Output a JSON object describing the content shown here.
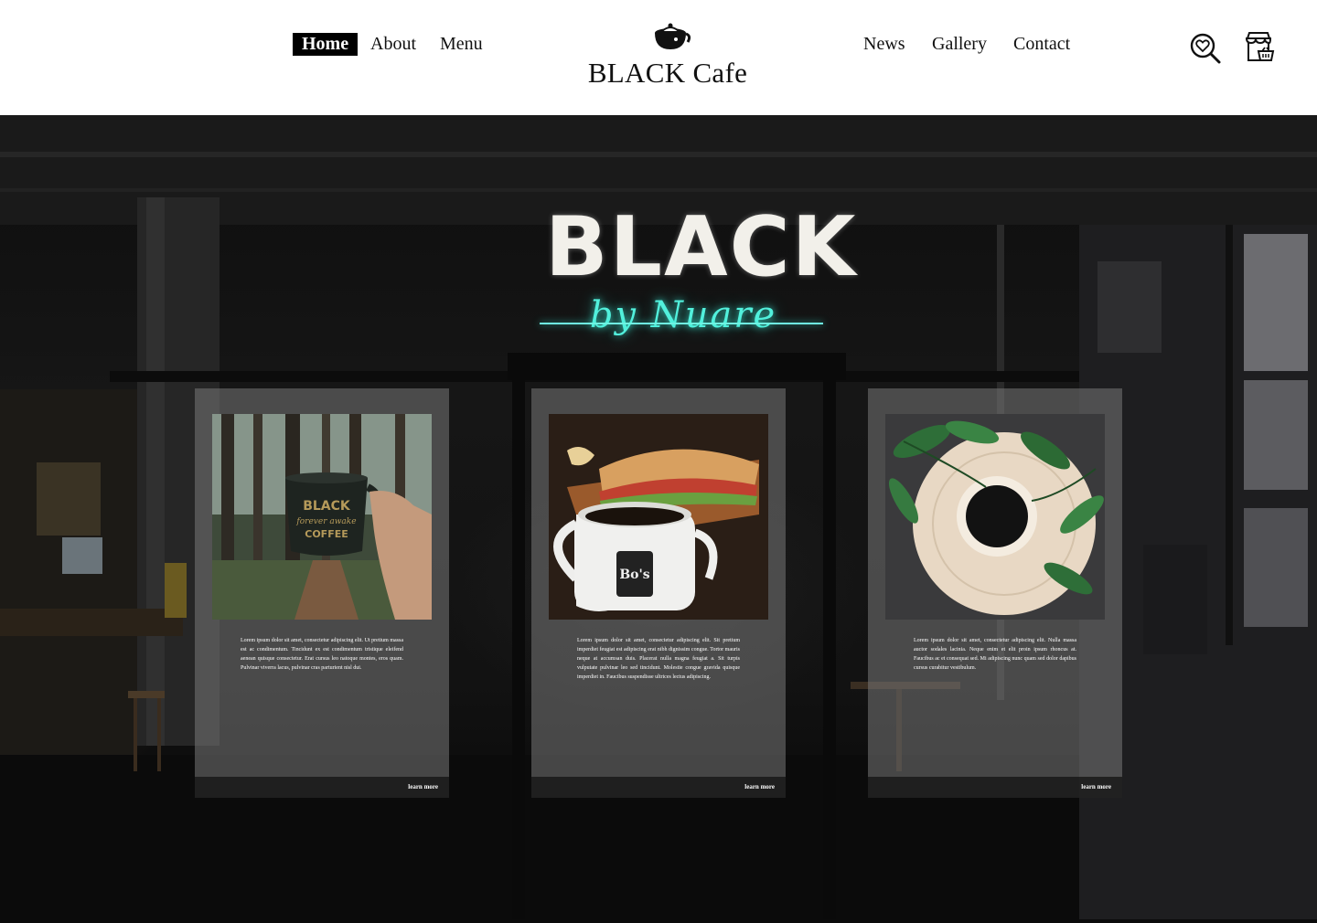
{
  "header": {
    "nav_left": [
      "Home",
      "About",
      "Menu"
    ],
    "nav_right": [
      "News",
      "Gallery",
      "Contact"
    ],
    "active": "Home",
    "brand": "BLACK Cafe"
  },
  "hero": {
    "sign_text": "BLACK",
    "sign_script": "by Nuare",
    "mug_print": [
      "BLACK",
      "forever awake",
      "COFFEE"
    ],
    "cup_print": "Bo's"
  },
  "cards": [
    {
      "text": "Lorem ipsum dolor sit amet, consectetur adipiscing elit. Ut pretium massa est ac condimentum. Tincidunt ex est condimentum tristique eleifend aenean quisque consectetur. Erat cursus leo natoque montes, eros quam. Pulvinar viverra lacus, pulvinar cras parturient nisl dui.",
      "link": "learn more"
    },
    {
      "text": "Lorem ipsum dolor sit amet, consectetur adipiscing elit. Sit pretium imperdiet feugiat est adipiscing erat nibh dignissim congue. Tortor mauris neque at accumsan duis. Placerat nulla magna feugiat a. Sit turpis vulputate pulvinar leo sed tincidunt. Molestie congue gravida quisque imperdiet in. Faucibus suspendisse ultrices lectus adipiscing.",
      "link": "learn more"
    },
    {
      "text": "Lorem ipsum dolor sit amet, consectetur adipiscing elit. Nulla massa auctor sodales lacinia. Neque enim et elit proin ipsum rhoncus at. Faucibus ac et consequat sed. Mi adipiscing nunc quam sed dolor dapibus cursus curabitur vestibulum.",
      "link": "learn more"
    }
  ],
  "icons": {
    "logo": "coffee-pot-icon",
    "search": "heart-search-icon",
    "shop": "shop-basket-icon"
  },
  "colors": {
    "header_bg": "#ffffff",
    "active_nav_bg": "#000000",
    "neon_teal": "#52f0dc",
    "card_bg": "#787878"
  }
}
